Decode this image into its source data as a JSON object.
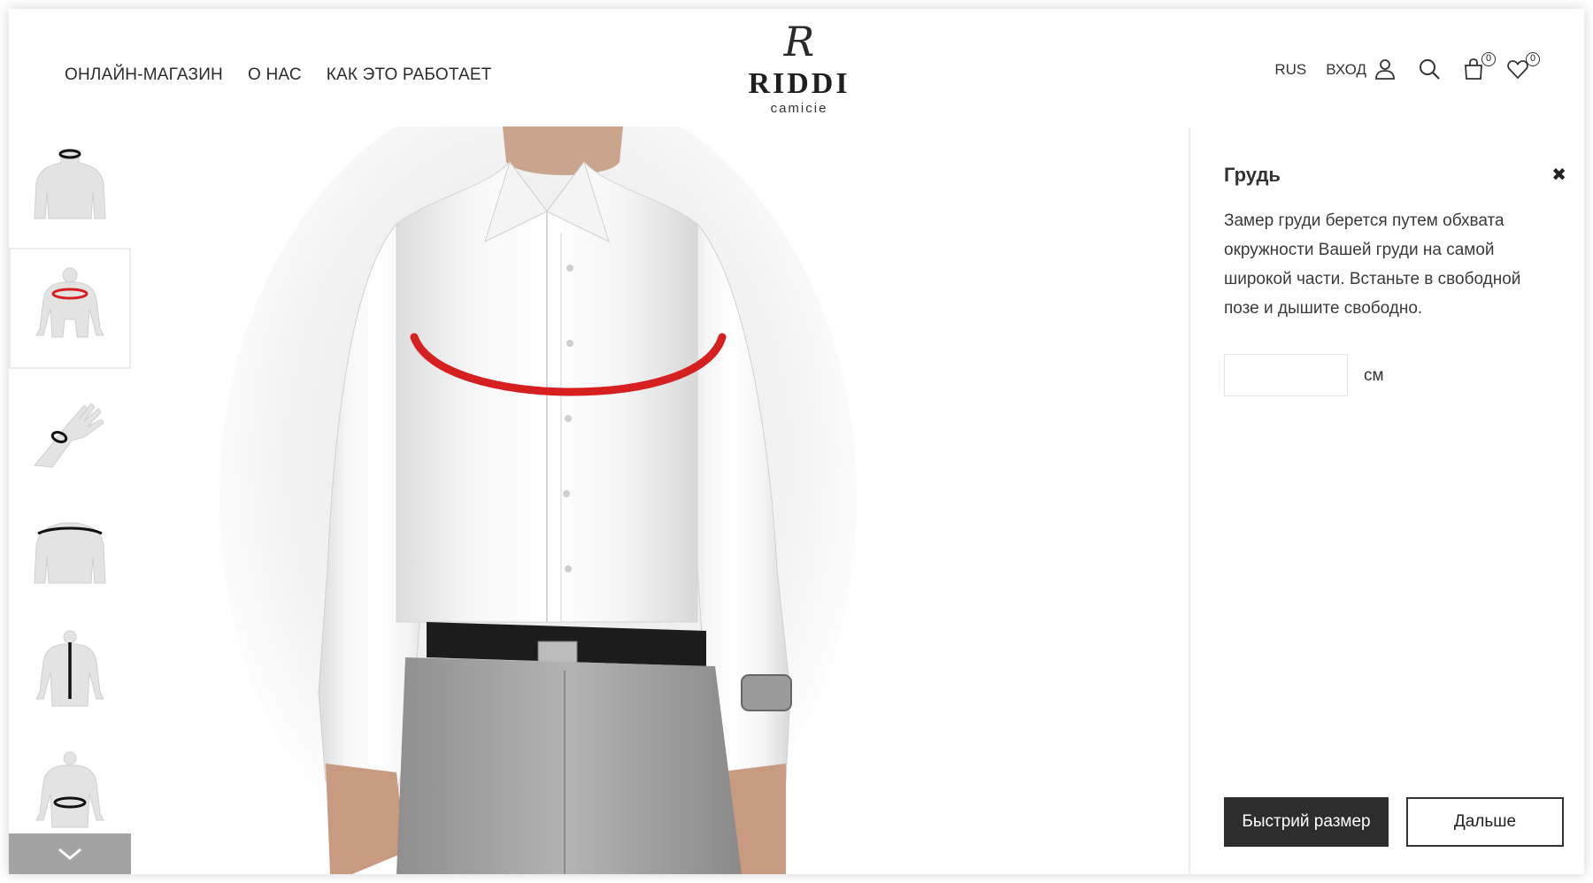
{
  "nav": {
    "items": [
      {
        "label": "ОНЛАЙН-МАГАЗИН"
      },
      {
        "label": "О НАС"
      },
      {
        "label": "КАК ЭТО РАБОТАЕТ"
      }
    ]
  },
  "logo": {
    "monogram": "R",
    "name": "RIDDI",
    "subtitle": "camicie"
  },
  "header_right": {
    "language": "RUS",
    "login_label": "ВХОД",
    "cart_count": "0",
    "wishlist_count": "0",
    "icons": [
      "user-icon",
      "search-icon",
      "shopping-bag-icon",
      "heart-icon"
    ]
  },
  "thumbnails": [
    {
      "name": "neck",
      "active": false
    },
    {
      "name": "chest",
      "active": true
    },
    {
      "name": "wrist",
      "active": false
    },
    {
      "name": "shoulders",
      "active": false
    },
    {
      "name": "back-length",
      "active": false
    },
    {
      "name": "waist",
      "active": false
    }
  ],
  "panel": {
    "title": "Грудь",
    "description": "Замер груди берется путем обхвата окружности Вашей груди на самой широкой части. Встаньте в свободной позе и дышите свободно.",
    "input_value": "",
    "unit": "см",
    "quick_size_label": "Быстрий размер",
    "next_label": "Дальше"
  },
  "colors": {
    "accent_measure": "#d62020",
    "button_dark": "#2d2d2d",
    "thumb_nav_bg": "#a3a3a3"
  }
}
